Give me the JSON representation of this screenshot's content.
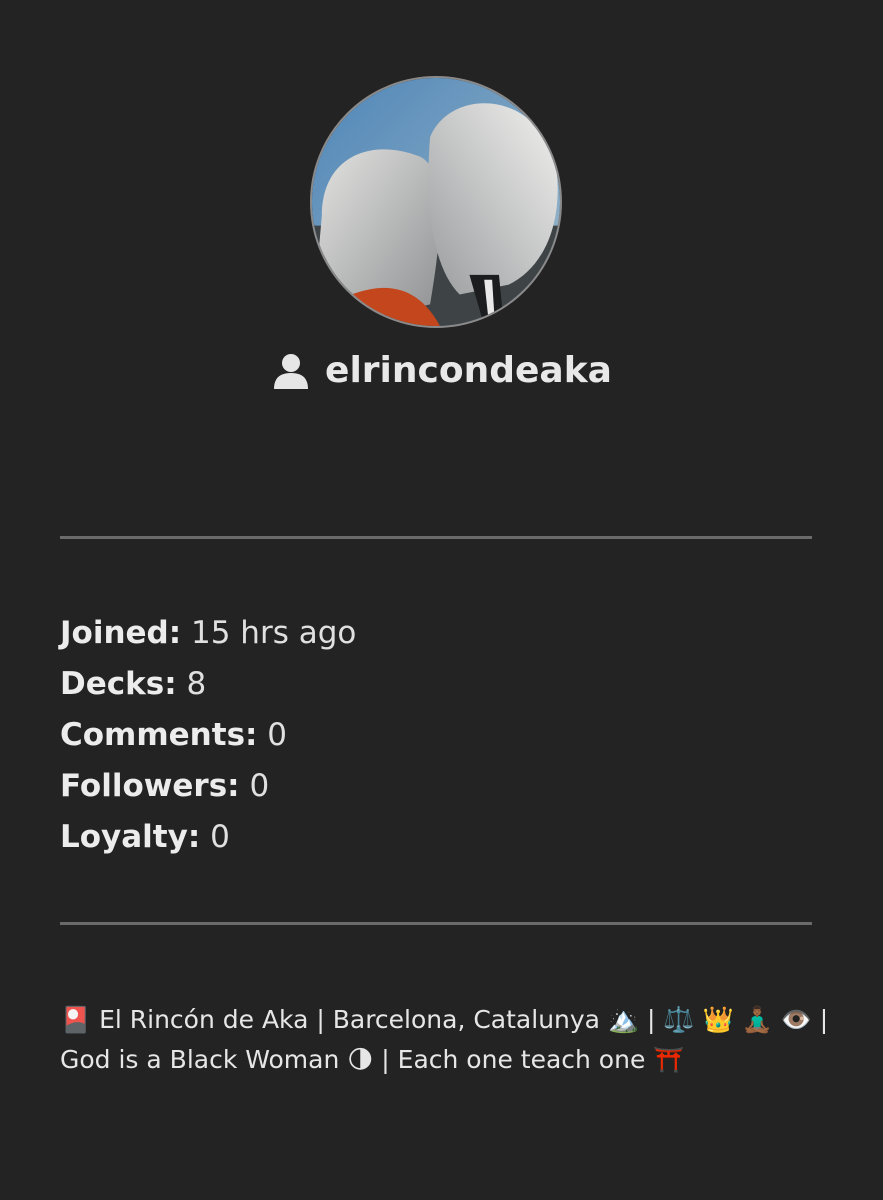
{
  "profile": {
    "avatar_description_icon": "avatar-painting",
    "username": "elrincondeaka",
    "user_icon": "user-icon"
  },
  "stats": [
    {
      "label": "Joined:",
      "value": "15 hrs ago"
    },
    {
      "label": "Decks:",
      "value": "8"
    },
    {
      "label": "Comments:",
      "value": "0"
    },
    {
      "label": "Followers:",
      "value": "0"
    },
    {
      "label": "Loyalty:",
      "value": "0"
    }
  ],
  "bio": {
    "text": "🎴 El Rincón de Aka | Barcelona, Catalunya 🏔️ | ⚖️ 👑 🧘🏾‍♂️ 👁️ | God is a Black Woman 🌗 | Each one teach one ⛩️"
  },
  "colors": {
    "background": "#232323",
    "text": "#e6e6e6",
    "divider": "#6a6a6a"
  }
}
